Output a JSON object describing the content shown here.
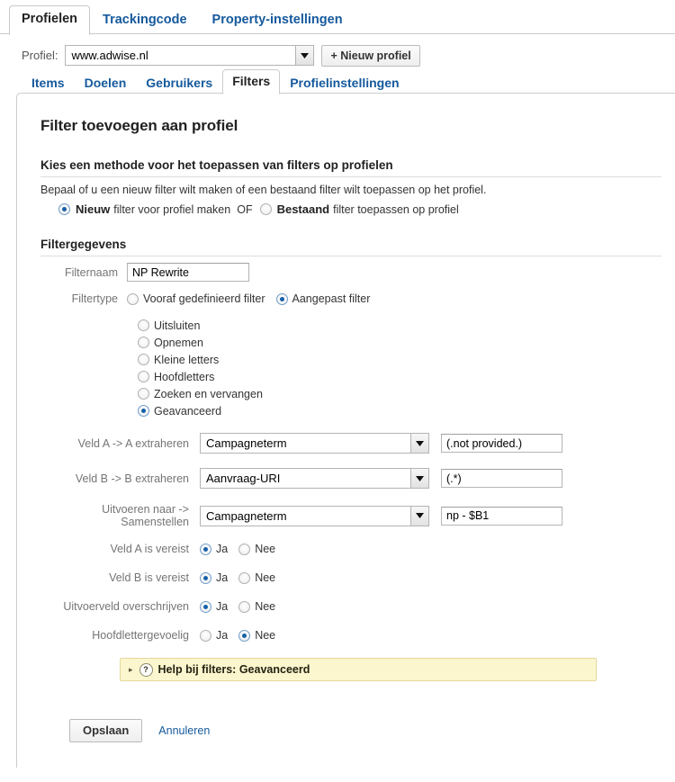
{
  "top_tabs": [
    {
      "label": "Profielen",
      "active": true
    },
    {
      "label": "Trackingcode",
      "active": false
    },
    {
      "label": "Property-instellingen",
      "active": false
    }
  ],
  "profile_bar": {
    "label": "Profiel:",
    "selected": "www.adwise.nl",
    "new_profile_button": "+ Nieuw profiel"
  },
  "sub_tabs": [
    {
      "label": "Items",
      "active": false
    },
    {
      "label": "Doelen",
      "active": false
    },
    {
      "label": "Gebruikers",
      "active": false
    },
    {
      "label": "Filters",
      "active": true
    },
    {
      "label": "Profielinstellingen",
      "active": false
    }
  ],
  "page": {
    "title": "Filter toevoegen aan profiel"
  },
  "method_section": {
    "heading": "Kies een methode voor het toepassen van filters op profielen",
    "description": "Bepaal of u een nieuw filter wilt maken of een bestaand filter wilt toepassen op het profiel.",
    "option_new_strong": "Nieuw",
    "option_new_rest": "filter voor profiel maken",
    "or": "OF",
    "option_existing_strong": "Bestaand",
    "option_existing_rest": "filter toepassen op profiel"
  },
  "details_section": {
    "heading": "Filtergegevens",
    "filtername_label": "Filternaam",
    "filtername_value": "NP Rewrite",
    "filtername_placeholder": "",
    "filtertype_label": "Filtertype",
    "filtertype_predefined": "Vooraf gedefinieerd filter",
    "filtertype_custom": "Aangepast filter",
    "type_options": [
      {
        "label": "Uitsluiten",
        "checked": false
      },
      {
        "label": "Opnemen",
        "checked": false
      },
      {
        "label": "Kleine letters",
        "checked": false
      },
      {
        "label": "Hoofdletters",
        "checked": false
      },
      {
        "label": "Zoeken en vervangen",
        "checked": false
      },
      {
        "label": "Geavanceerd",
        "checked": true
      }
    ]
  },
  "advanced": {
    "rows": [
      {
        "label": "Veld A -> A extraheren",
        "select_value": "Campagneterm",
        "text_value": "(.not provided.)"
      },
      {
        "label": "Veld B -> B extraheren",
        "select_value": "Aanvraag-URI",
        "text_value": "(.*)"
      },
      {
        "label": "Uitvoeren naar -> Samenstellen",
        "select_value": "Campagneterm",
        "text_value": "np - $B1"
      }
    ],
    "yes_label": "Ja",
    "no_label": "Nee",
    "yesno_rows": [
      {
        "label": "Veld A is vereist",
        "value": "Ja"
      },
      {
        "label": "Veld B is vereist",
        "value": "Ja"
      },
      {
        "label": "Uitvoerveld overschrijven",
        "value": "Ja"
      },
      {
        "label": "Hoofdlettergevoelig",
        "value": "Nee"
      }
    ]
  },
  "help_bar": {
    "text": "Help bij filters: Geavanceerd",
    "question_mark": "?",
    "triangle": "▸"
  },
  "footer": {
    "save_label": "Opslaan",
    "cancel_label": "Annuleren"
  },
  "colors": {
    "link": "#15599c",
    "radio_dot": "#1761a8",
    "help_bg": "#fcf6cf",
    "help_border": "#e3d89a",
    "panel_border": "#cccccc"
  }
}
